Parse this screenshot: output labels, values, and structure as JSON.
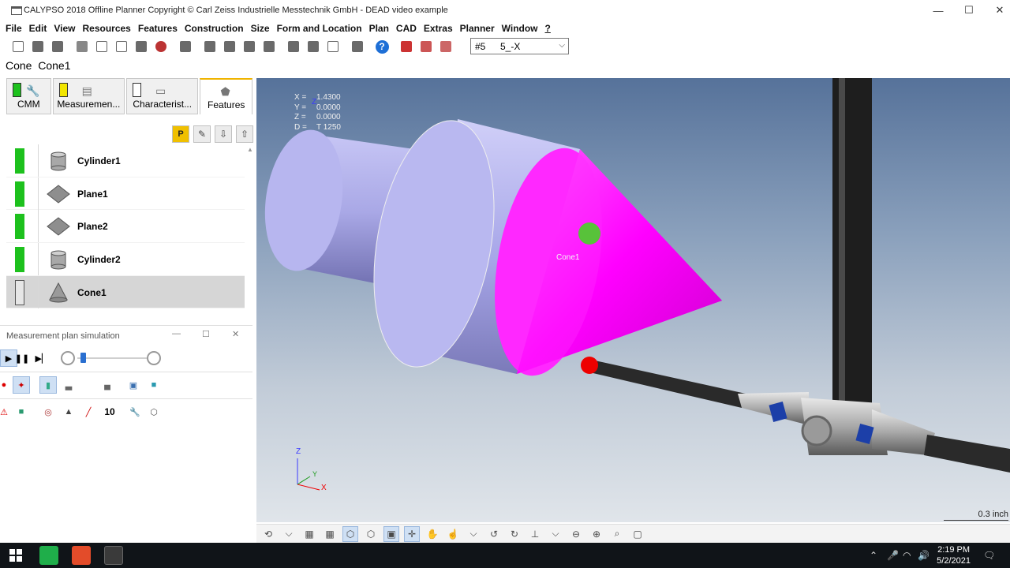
{
  "window": {
    "title": "CALYPSO 2018 Offline Planner Copyright © Carl Zeiss Industrielle Messtechnik GmbH - DEAD video example",
    "controls": {
      "minimize": "—",
      "maximize": "☐",
      "close": "✕"
    }
  },
  "menu": [
    "File",
    "Edit",
    "View",
    "Resources",
    "Features",
    "Construction",
    "Size",
    "Form and Location",
    "Plan",
    "CAD",
    "Extras",
    "Planner",
    "Window",
    "?"
  ],
  "toolbar": {
    "help_glyph": "?",
    "combo": {
      "value_a": "#5",
      "value_b": "5_-X"
    }
  },
  "feature_header": {
    "type": "Cone",
    "name": "Cone1"
  },
  "tabs": [
    {
      "label": "CMM",
      "status": "#1dc11d",
      "icon": "wrench-icon",
      "active": false
    },
    {
      "label": "Measuremen...",
      "status": "#f2e600",
      "icon": "measurement-icon",
      "active": false
    },
    {
      "label": "Characterist...",
      "status": "#ffffff",
      "icon": "characteristic-icon",
      "active": false
    },
    {
      "label": "Features",
      "status": "",
      "icon": "features-icon",
      "active": true
    }
  ],
  "list_tools": {
    "p_label": "P"
  },
  "features": [
    {
      "name": "Cylinder1",
      "shape": "cylinder",
      "status": "#1dc11d",
      "selected": false
    },
    {
      "name": "Plane1",
      "shape": "plane",
      "status": "#1dc11d",
      "selected": false
    },
    {
      "name": "Plane2",
      "shape": "plane",
      "status": "#1dc11d",
      "selected": false
    },
    {
      "name": "Cylinder2",
      "shape": "cylinder",
      "status": "#1dc11d",
      "selected": false
    },
    {
      "name": "Cone1",
      "shape": "cone",
      "status": "#e6e6e6",
      "selected": true
    }
  ],
  "simulation": {
    "title": "Measurement plan simulation",
    "controls": {
      "minimize": "—",
      "maximize": "☐",
      "close": "✕"
    },
    "count_value": "10"
  },
  "viewport": {
    "coords": [
      {
        "k": "X =",
        "v": "1.4300"
      },
      {
        "k": "Y =",
        "v": "0.0000"
      },
      {
        "k": "Z =",
        "v": "0.0000"
      },
      {
        "k": "D =",
        "v": "T 1250"
      }
    ],
    "feature_label": "Cone1",
    "axes": {
      "z": "Z",
      "y": "Y",
      "x": "X",
      "z_small": "Z"
    },
    "scale": "0.3 inch"
  },
  "taskbar": {
    "time": "2:19 PM",
    "date": "5/2/2021"
  },
  "colors": {
    "cone": "#ff00ff",
    "cylinder": "#a7a6e8",
    "status_ok": "#1dc11d"
  }
}
